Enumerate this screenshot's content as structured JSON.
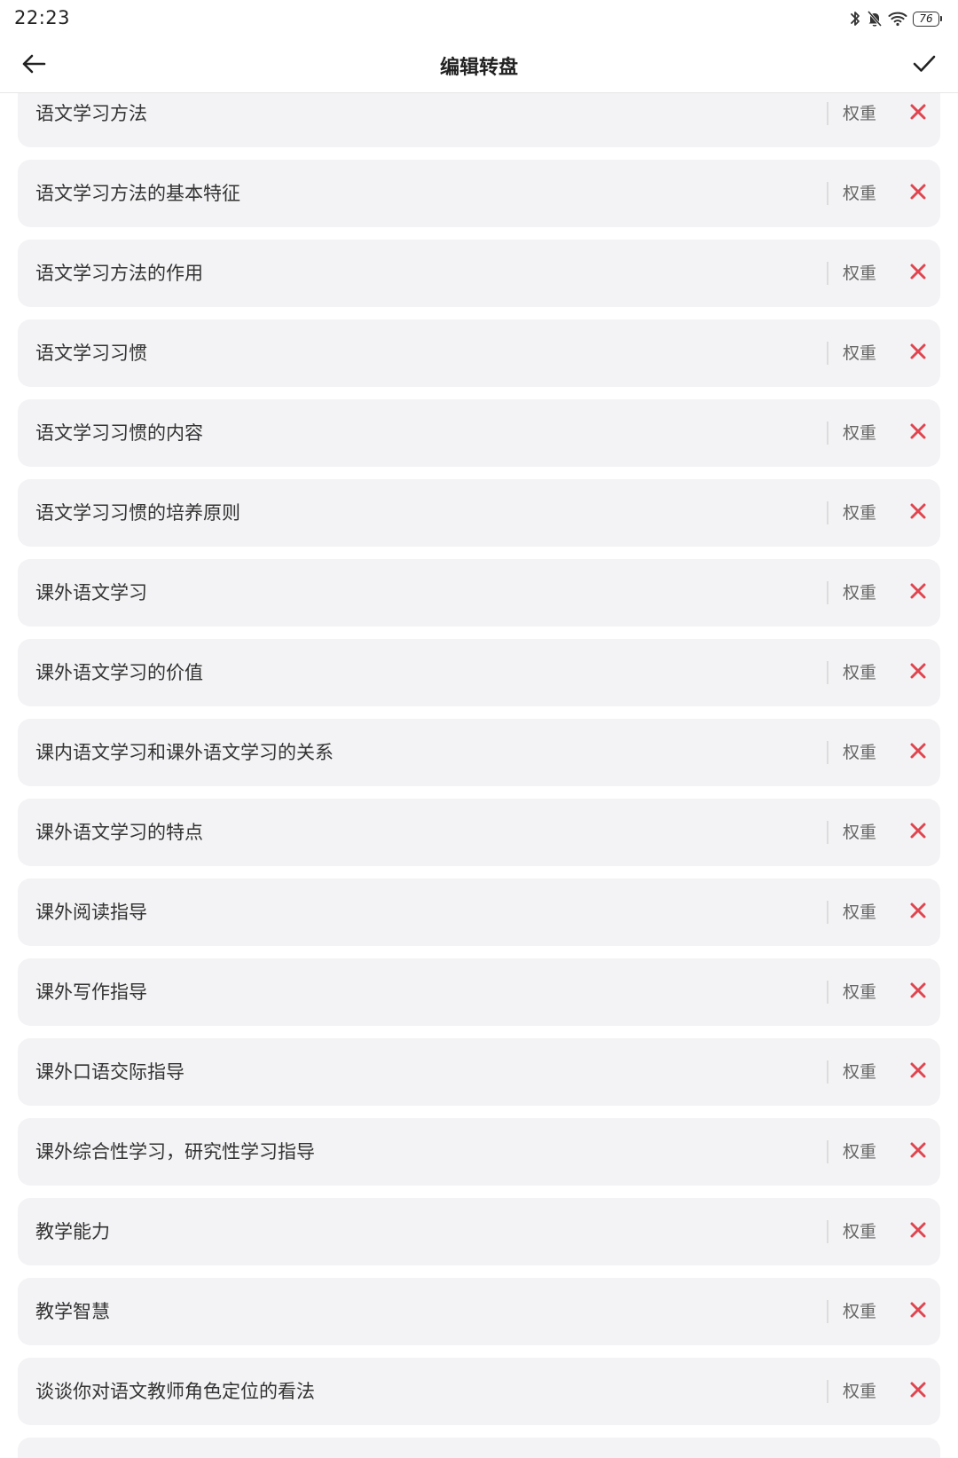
{
  "status_bar": {
    "time": "22:23",
    "icons": [
      "bluetooth-icon",
      "bell-muted-icon",
      "wifi-icon",
      "battery-icon"
    ],
    "battery_level": "76"
  },
  "header": {
    "title": "编辑转盘",
    "back_icon": "arrow-left-icon",
    "confirm_icon": "checkmark-icon"
  },
  "colors": {
    "delete": "#e0454f",
    "item_background": "#f3f3f5"
  },
  "items": [
    {
      "label": "语文学习方法",
      "weight_label": "权重"
    },
    {
      "label": "语文学习方法的基本特征",
      "weight_label": "权重"
    },
    {
      "label": "语文学习方法的作用",
      "weight_label": "权重"
    },
    {
      "label": "语文学习习惯",
      "weight_label": "权重"
    },
    {
      "label": "语文学习习惯的内容",
      "weight_label": "权重"
    },
    {
      "label": "语文学习习惯的培养原则",
      "weight_label": "权重"
    },
    {
      "label": "课外语文学习",
      "weight_label": "权重"
    },
    {
      "label": "课外语文学习的价值",
      "weight_label": "权重"
    },
    {
      "label": "课内语文学习和课外语文学习的关系",
      "weight_label": "权重"
    },
    {
      "label": "课外语文学习的特点",
      "weight_label": "权重"
    },
    {
      "label": "课外阅读指导",
      "weight_label": "权重"
    },
    {
      "label": "课外写作指导",
      "weight_label": "权重"
    },
    {
      "label": "课外口语交际指导",
      "weight_label": "权重"
    },
    {
      "label": "课外综合性学习，研究性学习指导",
      "weight_label": "权重"
    },
    {
      "label": "教学能力",
      "weight_label": "权重"
    },
    {
      "label": "教学智慧",
      "weight_label": "权重"
    },
    {
      "label": "谈谈你对语文教师角色定位的看法",
      "weight_label": "权重"
    },
    {
      "label": "",
      "weight_label": ""
    }
  ]
}
